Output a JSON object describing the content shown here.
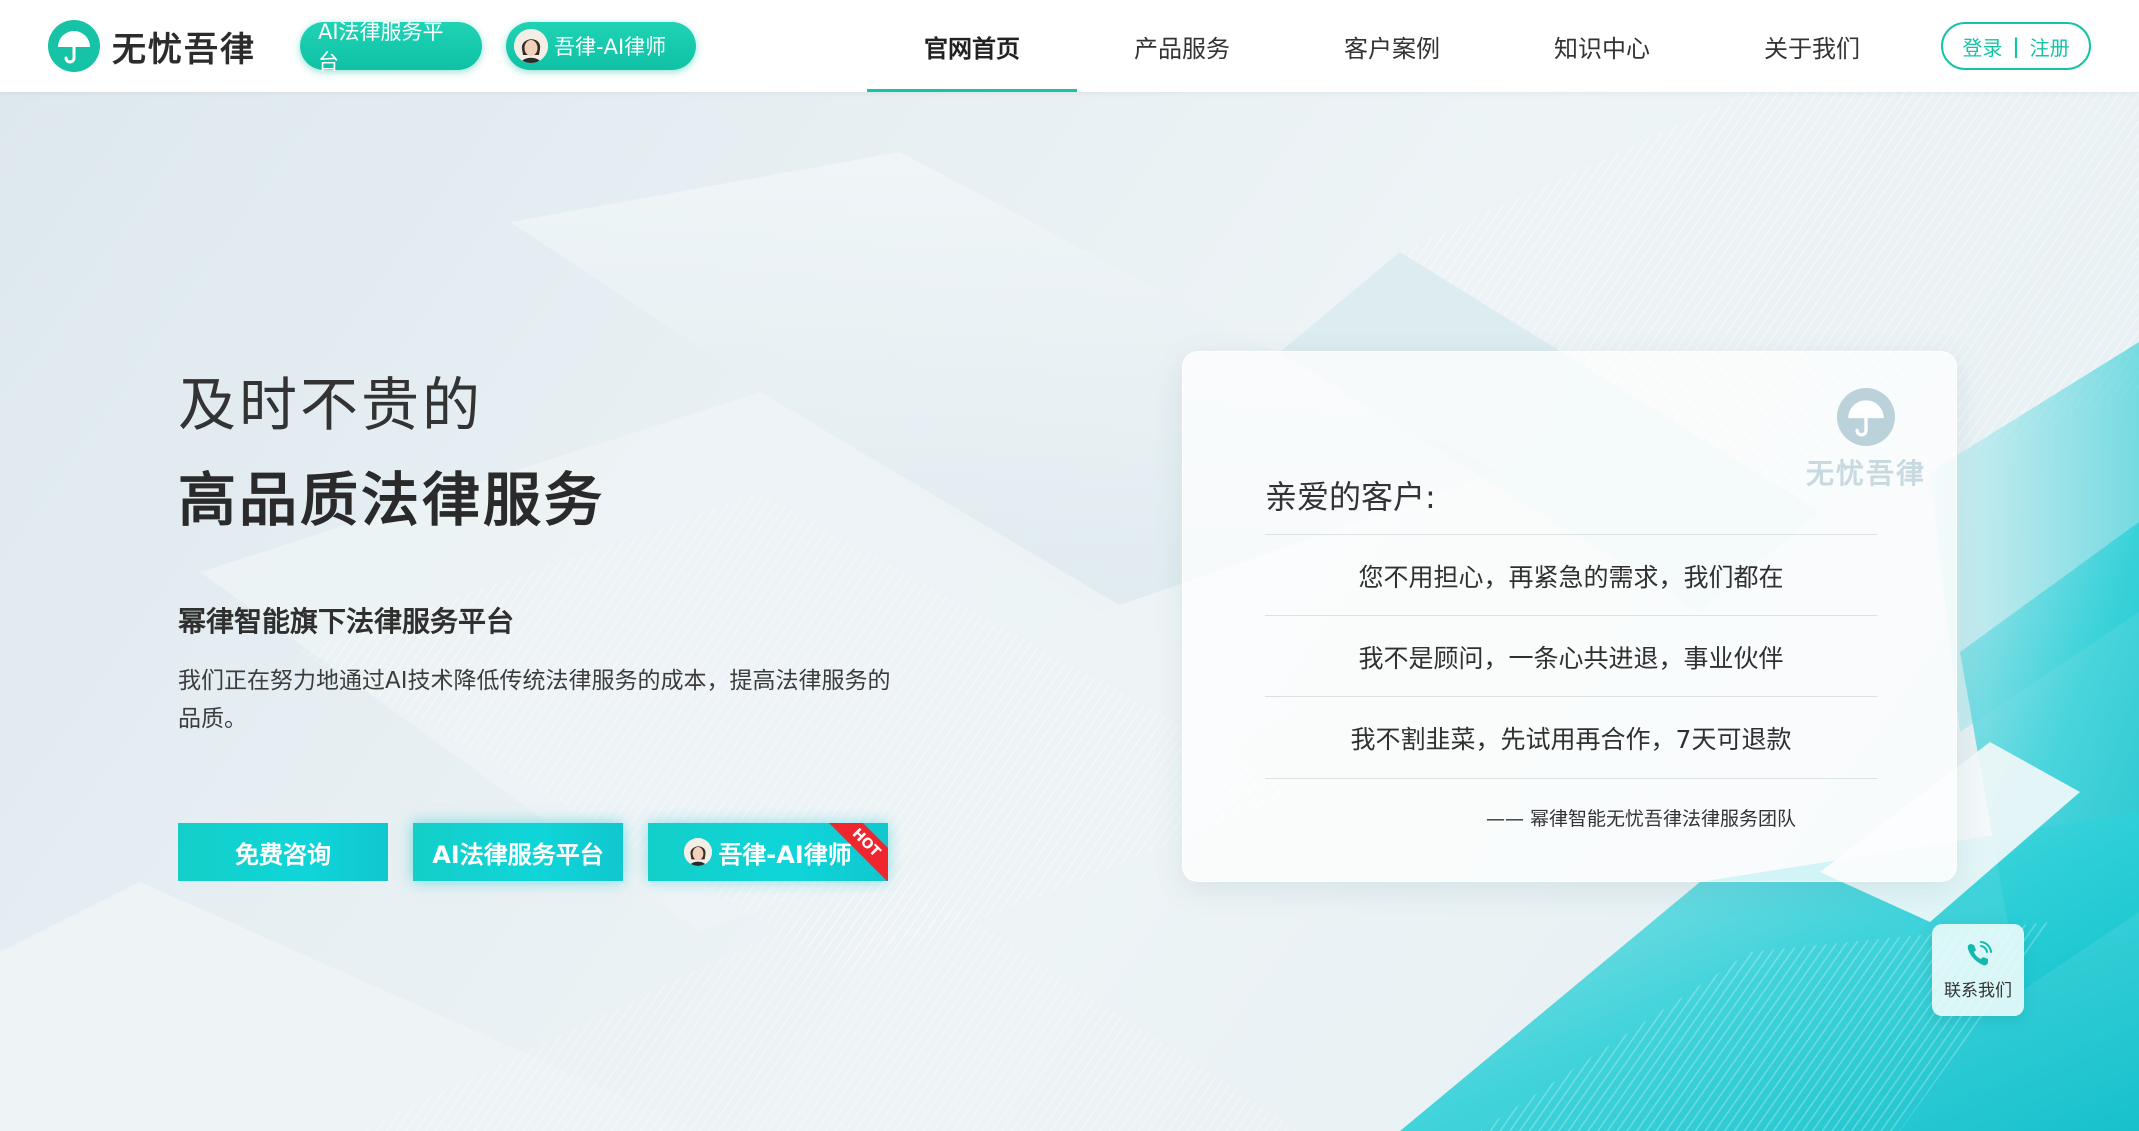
{
  "header": {
    "logo_text": "无忧吾律",
    "ai_platform_pill": "AI法律服务平台",
    "ai_lawyer_pill": "吾律-AI律师",
    "nav": [
      {
        "label": "官网首页",
        "active": true
      },
      {
        "label": "产品服务"
      },
      {
        "label": "客户案例"
      },
      {
        "label": "知识中心"
      },
      {
        "label": "关于我们"
      }
    ],
    "login": "登录",
    "separator": "|",
    "register": "注册"
  },
  "hero": {
    "line1": "及时不贵的",
    "line2": "高品质法律服务",
    "subtitle": "幂律智能旗下法律服务平台",
    "description": "我们正在努力地通过AI技术降低传统法律服务的成本，提高法律服务的品质。",
    "buttons": {
      "consult": "免费咨询",
      "ai_platform": "AI法律服务平台",
      "ai_lawyer": "吾律-AI律师",
      "hot_badge": "HOT"
    }
  },
  "card": {
    "logo_text": "无忧吾律",
    "greeting": "亲爱的客户:",
    "promises": [
      "您不用担心，再紧急的需求，我们都在",
      "我不是顾问，一条心共进退，事业伙伴",
      "我不割韭菜，先试用再合作，7天可退款"
    ],
    "signature": "—— 幂律智能无忧吾律法律服务团队"
  },
  "contact": {
    "label": "联系我们"
  },
  "colors": {
    "brand": "#17c3a6",
    "button": "#10d0d4",
    "hot": "#f0262f"
  },
  "icons": {
    "logo": "umbrella-icon",
    "contact": "phone-icon",
    "avatar": "lawyer-avatar-icon"
  }
}
